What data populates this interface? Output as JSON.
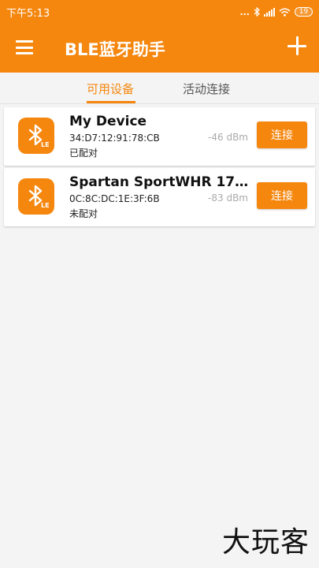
{
  "statusbar": {
    "time": "下午5:13",
    "more": "...",
    "battery": "19"
  },
  "appbar": {
    "title": "BLE蓝牙助手"
  },
  "tabs": [
    {
      "label": "可用设备",
      "active": true
    },
    {
      "label": "活动连接",
      "active": false
    }
  ],
  "devices": [
    {
      "name": "My Device",
      "mac": "34:D7:12:91:78:CB",
      "status": "已配对",
      "rssi": "-46 dBm",
      "connect_label": "连接",
      "icon_badge": "LE"
    },
    {
      "name": "Spartan SportWHR 17301...",
      "mac": "0C:8C:DC:1E:3F:6B",
      "status": "未配对",
      "rssi": "-83 dBm",
      "connect_label": "连接",
      "icon_badge": "LE"
    }
  ],
  "watermark": "大玩客",
  "colors": {
    "accent": "#f5870f",
    "background": "#f4f4f4",
    "rssi": "#aaaaaa"
  }
}
